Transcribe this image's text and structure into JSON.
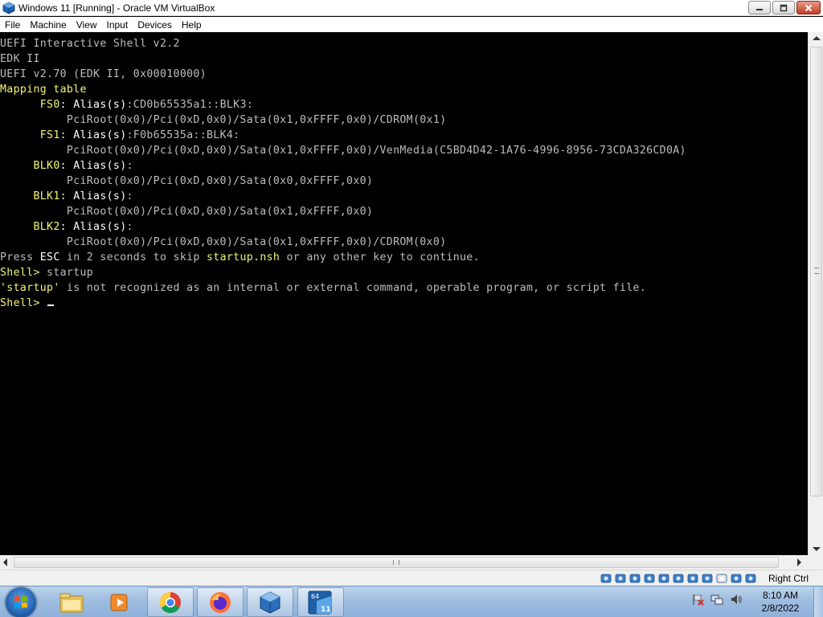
{
  "window": {
    "title": "Windows 11 [Running] - Oracle VM VirtualBox",
    "app_icon": "virtualbox-icon",
    "controls": [
      "minimize-icon",
      "maximize-icon",
      "close-icon"
    ]
  },
  "menubar": {
    "items": [
      "File",
      "Machine",
      "View",
      "Input",
      "Devices",
      "Help"
    ]
  },
  "terminal": {
    "lines": [
      [
        {
          "t": "UEFI Interactive Shell v2.2",
          "c": "g"
        }
      ],
      [
        {
          "t": "EDK II",
          "c": "g"
        }
      ],
      [
        {
          "t": "UEFI v2.70 (EDK II, 0x00010000)",
          "c": "g"
        }
      ],
      [
        {
          "t": "Mapping table",
          "c": "y"
        }
      ],
      [
        {
          "t": "      FS0",
          "c": "y"
        },
        {
          "t": ": Alias(s)",
          "c": "w"
        },
        {
          "t": ":CD0b65535a1::BLK3:",
          "c": "g"
        }
      ],
      [
        {
          "t": "          PciRoot(0x0)/Pci(0xD,0x0)/Sata(0x1,0xFFFF,0x0)/CDROM(0x1)",
          "c": "g"
        }
      ],
      [
        {
          "t": "      FS1",
          "c": "y"
        },
        {
          "t": ": Alias(s)",
          "c": "w"
        },
        {
          "t": ":F0b65535a::BLK4:",
          "c": "g"
        }
      ],
      [
        {
          "t": "          PciRoot(0x0)/Pci(0xD,0x0)/Sata(0x1,0xFFFF,0x0)/VenMedia(C5BD4D42-1A76-4996-8956-73CDA326CD0A)",
          "c": "g"
        }
      ],
      [
        {
          "t": "     BLK0",
          "c": "y"
        },
        {
          "t": ": Alias(s)",
          "c": "w"
        },
        {
          "t": ":",
          "c": "g"
        }
      ],
      [
        {
          "t": "          PciRoot(0x0)/Pci(0xD,0x0)/Sata(0x0,0xFFFF,0x0)",
          "c": "g"
        }
      ],
      [
        {
          "t": "     BLK1",
          "c": "y"
        },
        {
          "t": ": Alias(s)",
          "c": "w"
        },
        {
          "t": ":",
          "c": "g"
        }
      ],
      [
        {
          "t": "          PciRoot(0x0)/Pci(0xD,0x0)/Sata(0x1,0xFFFF,0x0)",
          "c": "g"
        }
      ],
      [
        {
          "t": "     BLK2",
          "c": "y"
        },
        {
          "t": ": Alias(s)",
          "c": "w"
        },
        {
          "t": ":",
          "c": "g"
        }
      ],
      [
        {
          "t": "          PciRoot(0x0)/Pci(0xD,0x0)/Sata(0x1,0xFFFF,0x0)/CDROM(0x0)",
          "c": "g"
        }
      ],
      [
        {
          "t": "Press ",
          "c": "g"
        },
        {
          "t": "ESC",
          "c": "w"
        },
        {
          "t": " in 2 seconds to skip ",
          "c": "g"
        },
        {
          "t": "startup.nsh",
          "c": "y"
        },
        {
          "t": " or any other key to continue.",
          "c": "g"
        }
      ],
      [
        {
          "t": "Shell> ",
          "c": "y"
        },
        {
          "t": "startup",
          "c": "g"
        }
      ],
      [
        {
          "t": "'startup'",
          "c": "y"
        },
        {
          "t": " is not recognized as an internal or external command, operable program, or script file.",
          "c": "g"
        }
      ],
      [
        {
          "t": "Shell> ",
          "c": "y"
        }
      ]
    ],
    "colors": {
      "yellow": "#f4f476",
      "white": "#ffffff",
      "gray": "#bdbdbd",
      "background": "#000000"
    }
  },
  "statusbar": {
    "icons": [
      "hard-disk-icon",
      "optical-drive-icon",
      "audio-icon",
      "network-icon",
      "usb-icon",
      "shared-folders-icon",
      "display-icon",
      "video-capture-icon",
      "virtualization-icon",
      "mouse-integration-icon",
      "keyboard-capture-icon"
    ],
    "host_key": "Right Ctrl"
  },
  "taskbar": {
    "start": "windows-start-orb-icon",
    "apps": [
      {
        "name": "file-explorer-icon",
        "open": false
      },
      {
        "name": "media-player-icon",
        "open": false
      },
      {
        "name": "chrome-icon",
        "open": true
      },
      {
        "name": "firefox-icon",
        "open": true
      },
      {
        "name": "virtualbox-icon",
        "open": true
      },
      {
        "name": "windows-11-vm-icon",
        "open": true,
        "badge_top": "64",
        "badge_bottom": "11"
      }
    ],
    "tray_icons": [
      "action-center-flag-icon",
      "network-tray-icon",
      "volume-icon"
    ],
    "clock_time": "8:10 AM",
    "clock_date": "2/8/2022"
  }
}
